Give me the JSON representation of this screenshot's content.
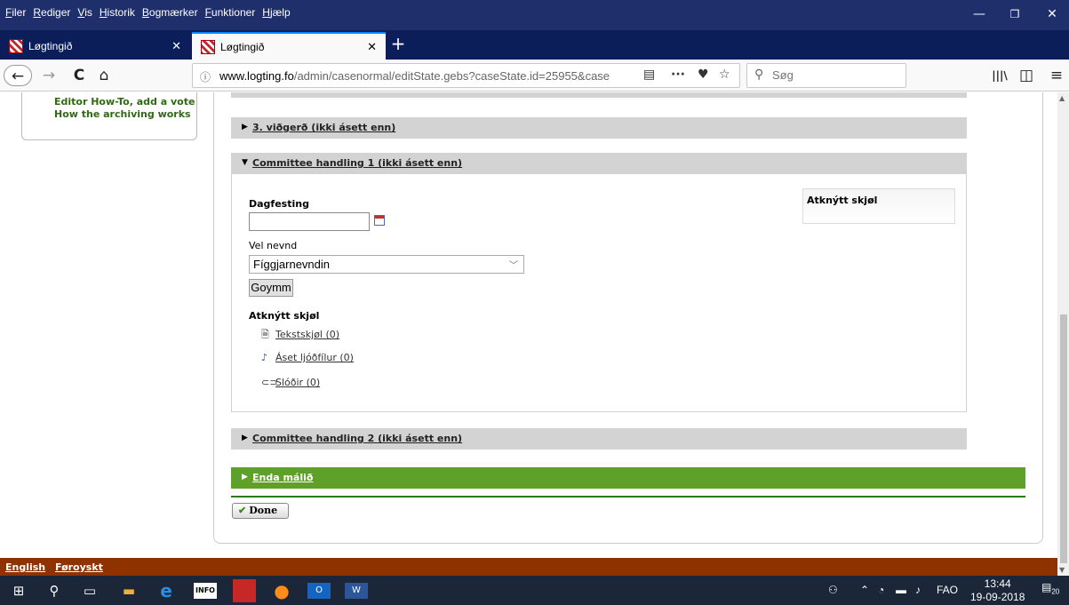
{
  "menu": [
    "Filer",
    "Rediger",
    "Vis",
    "Historik",
    "Bogmærker",
    "Funktioner",
    "Hjælp"
  ],
  "window_controls": {
    "minimize": "—",
    "restore": "❐",
    "close": "✕"
  },
  "tabs": [
    {
      "title": "Løgtingið",
      "close": "✕",
      "active": false
    },
    {
      "title": "Løgtingið",
      "close": "✕",
      "active": true
    }
  ],
  "new_tab": "+",
  "nav": {
    "back": "←",
    "forward": "→",
    "reload": "C",
    "home": "⌂"
  },
  "url": {
    "domain": "www.logting.fo",
    "path": "/admin/casenormal/editState.gebs?caseState.id=25955&case"
  },
  "url_icons": {
    "reader": "▤",
    "more": "···",
    "pocket": "♥",
    "bookmark": "☆"
  },
  "search": {
    "placeholder": "Søg",
    "icon": "search-icon"
  },
  "right_tools": {
    "library": "|||\\",
    "sidebar": "◫",
    "menu": "≡"
  },
  "left_nav": [
    "Editor How-To, add a vote",
    "How the archiving works"
  ],
  "sections": {
    "third": {
      "label": "3. viðgerð (ikki ásett enn)",
      "expanded": false
    },
    "committee1": {
      "label": "Committee handling 1 (ikki ásett enn)",
      "expanded": true
    },
    "committee2": {
      "label": "Committee handling 2 (ikki ásett enn)",
      "expanded": false
    },
    "enda": {
      "label": "Enda málið",
      "expanded": false
    }
  },
  "form": {
    "date_label": "Dagfesting",
    "date_value": "",
    "nevnd_label": "Vel nevnd",
    "nevnd_value": "Fíggjarnevndin",
    "save_label": "Goymm"
  },
  "attachments": {
    "title": "Atknýtt skjøl",
    "items": [
      {
        "label": "Tekstskjøl (0)",
        "icon": "document-icon"
      },
      {
        "label": "Áset ljóðfílur (0)",
        "icon": "audio-file-icon"
      },
      {
        "label": "Slóðir (0)",
        "icon": "link-icon"
      }
    ]
  },
  "sidebox_title": "Atknýtt skjøl",
  "done_label": "Done",
  "footer": {
    "english": "English",
    "faroese": "Føroyskt"
  },
  "tray": {
    "lang": "FAO",
    "time": "13:44",
    "date": "19-09-2018",
    "notif": "20"
  },
  "colors": {
    "green": "#5ea12a",
    "footer": "#8e3300",
    "titlebar": "#1f2f6b",
    "link_green": "#2e6a12"
  }
}
